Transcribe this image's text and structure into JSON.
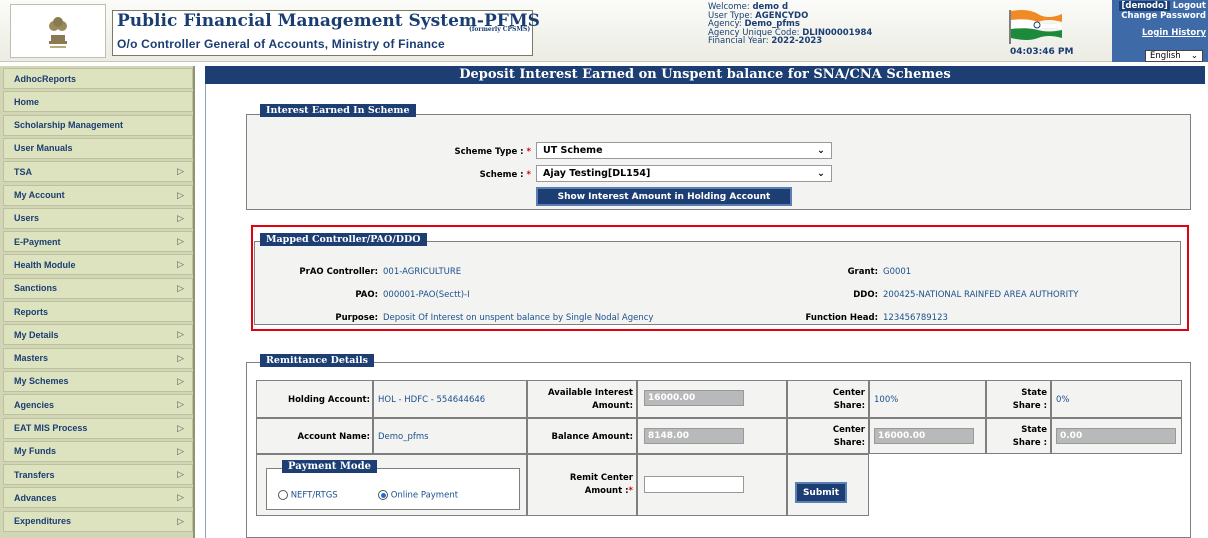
{
  "header": {
    "title": "Public Financial Management System-PFMS",
    "subtitle": "O/o Controller General of Accounts, Ministry of Finance",
    "formerly": "(formerly CPSMS)",
    "welcome_label": "Welcome:",
    "welcome_value": "demo d",
    "user_type_label": "User Type:",
    "user_type_value": "AGENCYDO",
    "agency_label": "Agency:",
    "agency_value": "Demo_pfms",
    "agency_code_label": "Agency Unique Code:",
    "agency_code_value": "DLIN00001984",
    "fy_label": "Financial Year:",
    "fy_value": "2022-2023",
    "clock": "04:03:46 PM",
    "user_link": "[demodo]",
    "logout": "Logout",
    "change_password": "Change Password",
    "login_history": "Login History",
    "language": "English"
  },
  "sidebar": {
    "items": [
      {
        "label": "AdhocReports",
        "arrow": ""
      },
      {
        "label": "Home",
        "arrow": ""
      },
      {
        "label": "Scholarship Management",
        "arrow": ""
      },
      {
        "label": "User Manuals",
        "arrow": ""
      },
      {
        "label": "TSA",
        "arrow": "▷"
      },
      {
        "label": "My Account",
        "arrow": "▷"
      },
      {
        "label": "Users",
        "arrow": "▷"
      },
      {
        "label": "E-Payment",
        "arrow": "▷"
      },
      {
        "label": "Health Module",
        "arrow": "▷"
      },
      {
        "label": "Sanctions",
        "arrow": "▷"
      },
      {
        "label": "Reports",
        "arrow": ""
      },
      {
        "label": "My Details",
        "arrow": "▷"
      },
      {
        "label": "Masters",
        "arrow": "▷"
      },
      {
        "label": "My Schemes",
        "arrow": "▷"
      },
      {
        "label": "Agencies",
        "arrow": "▷"
      },
      {
        "label": "EAT MIS Process",
        "arrow": "▷"
      },
      {
        "label": "My Funds",
        "arrow": "▷"
      },
      {
        "label": "Transfers",
        "arrow": "▷"
      },
      {
        "label": "Advances",
        "arrow": "▷"
      },
      {
        "label": "Expenditures",
        "arrow": "▷"
      }
    ]
  },
  "page": {
    "title": "Deposit Interest Earned on Unspent balance for SNA/CNA Schemes"
  },
  "interest": {
    "legend": "Interest Earned In Scheme",
    "scheme_type_label": "Scheme Type :",
    "scheme_type_value": "UT Scheme",
    "scheme_label": "Scheme :",
    "scheme_value": "Ajay Testing[DL154]",
    "show_button": "Show Interest Amount in Holding Account"
  },
  "mapped": {
    "legend": "Mapped Controller/PAO/DDO",
    "prao_label": "PrAO Controller:",
    "prao_value": "001-AGRICULTURE",
    "grant_label": "Grant:",
    "grant_value": "G0001",
    "pao_label": "PAO:",
    "pao_value": "000001-PAO(Sectt)-I",
    "ddo_label": "DDO:",
    "ddo_value": "200425-NATIONAL RAINFED AREA AUTHORITY",
    "purpose_label": "Purpose:",
    "purpose_value": "Deposit Of Interest on unspent balance by Single Nodal Agency",
    "function_head_label": "Function Head:",
    "function_head_value": "123456789123"
  },
  "remittance": {
    "legend": "Remittance Details",
    "holding_label": "Holding Account:",
    "holding_value": "HOL - HDFC - 554644646",
    "avail_label_1": "Available Interest",
    "avail_label_2": "Amount:",
    "avail_value": "16000.00",
    "center_share_label_1": "Center",
    "center_share_label_2": "Share:",
    "center_share_value": "100%",
    "state_share_label_1": "State",
    "state_share_label_2": "Share :",
    "state_share_value": "0%",
    "account_name_label": "Account Name:",
    "account_name_value": "Demo_pfms",
    "balance_label": "Balance Amount:",
    "balance_value": "8148.00",
    "center_share_amt_value": "16000.00",
    "state_share_amt_value": "0.00",
    "payment_mode_legend": "Payment Mode",
    "neft_label": "NEFT/RTGS",
    "online_label": "Online Payment",
    "remit_label_1": "Remit Center",
    "remit_label_2": "Amount :",
    "remit_value": "",
    "submit": "Submit"
  }
}
